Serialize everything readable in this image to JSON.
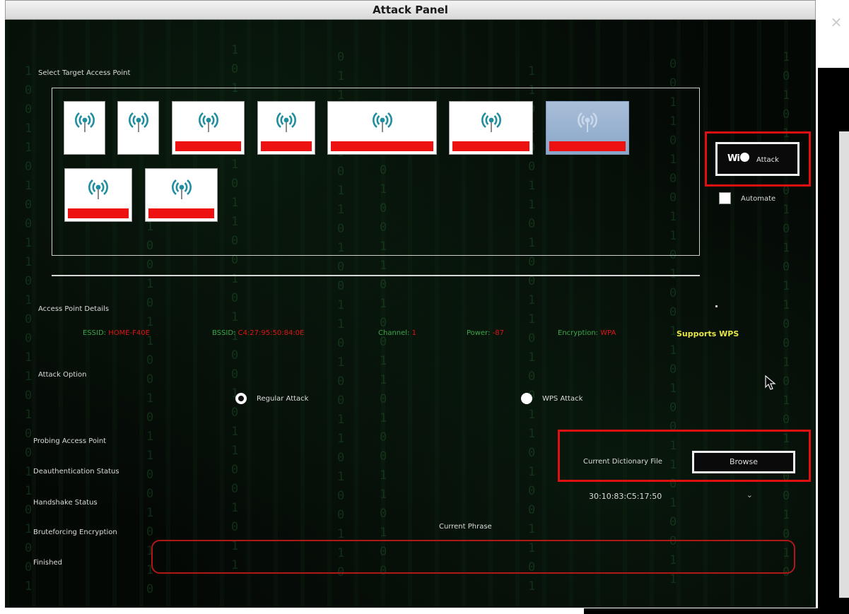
{
  "window": {
    "title": "Attack Panel",
    "close_glyph": "×"
  },
  "target_section": {
    "label": "Select Target Access Point",
    "access_points": [
      {
        "icon": "wifi-signal-icon",
        "selected": false
      },
      {
        "icon": "wifi-signal-icon",
        "selected": false
      },
      {
        "icon": "wifi-signal-icon",
        "selected": false,
        "name_redacted": true
      },
      {
        "icon": "wifi-signal-icon",
        "selected": false,
        "name_redacted": true
      },
      {
        "icon": "wifi-signal-icon",
        "selected": false,
        "name_redacted": true
      },
      {
        "icon": "wifi-signal-icon",
        "selected": false,
        "name_redacted": true
      },
      {
        "icon": "wifi-signal-icon",
        "selected": true,
        "name_redacted": true
      },
      {
        "icon": "wifi-signal-icon",
        "selected": false,
        "name_redacted": true
      },
      {
        "icon": "wifi-signal-icon",
        "selected": false,
        "name_redacted": true
      }
    ]
  },
  "attack_button": {
    "logo": "Wi",
    "label": "Attack"
  },
  "automate": {
    "label": "Automate",
    "checked": false
  },
  "details": {
    "label": "Access Point Details",
    "essid_key": "ESSID:",
    "essid_value": "HOME-F40E",
    "bssid_key": "BSSID:",
    "bssid_value": "C4:27:95:50:84:0E",
    "channel_key": "Channel:",
    "channel_value": "1",
    "power_key": "Power:",
    "power_value": "-87",
    "encryption_key": "Encryption:",
    "encryption_value": "WPA",
    "wps": "Supports WPS"
  },
  "attack_option": {
    "label": "Attack Option",
    "regular": "Regular Attack",
    "wps": "WPS Attack",
    "selected": "regular"
  },
  "status_list": [
    "Probing Access Point",
    "Deauthentication Status",
    "Handshake Status",
    "Bruteforcing Encryption",
    "Finished"
  ],
  "dictionary": {
    "label": "Current Dictionary File",
    "browse": "Browse"
  },
  "mac_select": {
    "value": "30:10:83:C5:17:50"
  },
  "phrase": {
    "label": "Current Phrase",
    "value": ""
  },
  "colors": {
    "panel_bg": "#040805",
    "highlight_red": "#e01010",
    "detail_key_green": "#3da64a",
    "detail_value_red": "#e01515",
    "wps_yellow": "#e6e64a",
    "selected_ap_blue": "#9ab3d2"
  }
}
